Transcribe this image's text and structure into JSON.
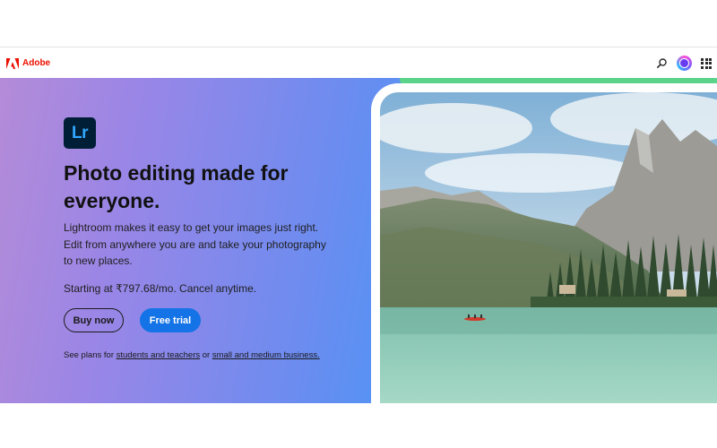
{
  "navbar": {
    "brand_label": "Adobe",
    "brand_color": "#eb1000",
    "icons": [
      "adobe-logo-icon",
      "search-icon",
      "avatar",
      "apps-grid-icon"
    ]
  },
  "hero": {
    "app_icon_text": "Lr",
    "headline": "Photo editing made for everyone.",
    "description": "Lightroom makes it easy to get your images just right. Edit from anywhere you are and take your photography to new places.",
    "price": "Starting at ₹797.68/mo. Cancel anytime.",
    "buy_label": "Buy now",
    "trial_label": "Free trial",
    "plans_prefix": "See plans for ",
    "plans_link1": "students and teachers",
    "plans_middle": " or ",
    "plans_link2": "small and medium business.",
    "accent_color": "#1473e6"
  },
  "photo": {
    "subject": "mountain lake landscape with red canoe"
  },
  "chat": {
    "icon": "chat-icon"
  }
}
